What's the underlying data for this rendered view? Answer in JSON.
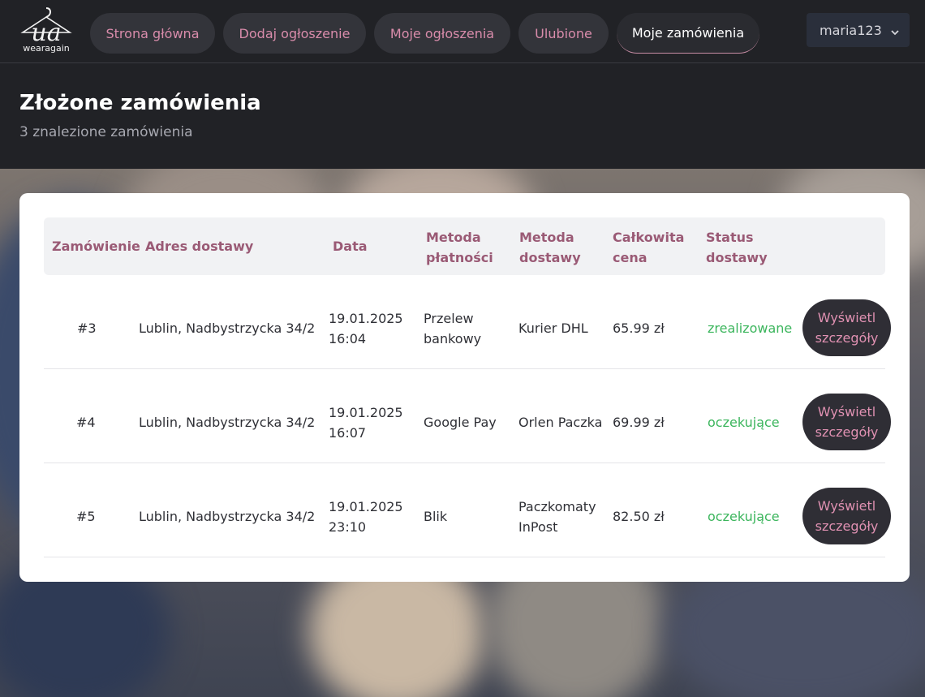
{
  "brand": {
    "logo_text": "wearagain"
  },
  "nav": {
    "items": [
      {
        "label": "Strona główna"
      },
      {
        "label": "Dodaj ogłoszenie"
      },
      {
        "label": "Moje ogłoszenia"
      },
      {
        "label": "Ulubione"
      },
      {
        "label": "Moje zamówienia",
        "active": true
      }
    ],
    "user": {
      "name": "maria123",
      "icon": "chevron-down-icon"
    }
  },
  "header": {
    "title": "Złożone zamówienia",
    "subtitle": "3 znalezione zamówienia"
  },
  "table": {
    "columns": [
      "Zamówienie",
      "Adres dostawy",
      "Data",
      "Metoda\npłatności",
      "Metoda\ndostawy",
      "Całkowita\ncena",
      "Status\ndostawy"
    ],
    "rows": [
      {
        "order": "#3",
        "address": "Lublin, Nadbystrzycka 34/2",
        "date": "19.01.2025",
        "time": "16:04",
        "payment_line1": "Przelew",
        "payment_line2": "bankowy",
        "delivery_line1": "Kurier DHL",
        "delivery_line2": "",
        "price": "65.99 zł",
        "status": "zrealizowane",
        "button": "Wyświetl szczegóły"
      },
      {
        "order": "#4",
        "address": "Lublin, Nadbystrzycka 34/2",
        "date": "19.01.2025",
        "time": "16:07",
        "payment_line1": "Google Pay",
        "payment_line2": "",
        "delivery_line1": "Orlen Paczka",
        "delivery_line2": "",
        "price": "69.99 zł",
        "status": "oczekujące",
        "button": "Wyświetl szczegóły"
      },
      {
        "order": "#5",
        "address": "Lublin, Nadbystrzycka 34/2",
        "date": "19.01.2025",
        "time": "23:10",
        "payment_line1": "Blik",
        "payment_line2": "",
        "delivery_line1": "Paczkomaty",
        "delivery_line2": "InPost",
        "price": "82.50 zł",
        "status": "oczekujące",
        "button": "Wyświetl szczegóły"
      }
    ]
  },
  "colors": {
    "nav_bg": "#212226",
    "accent_pink": "#d98cab",
    "status_green": "#3bb55c",
    "header_text": "#9a5a75"
  }
}
